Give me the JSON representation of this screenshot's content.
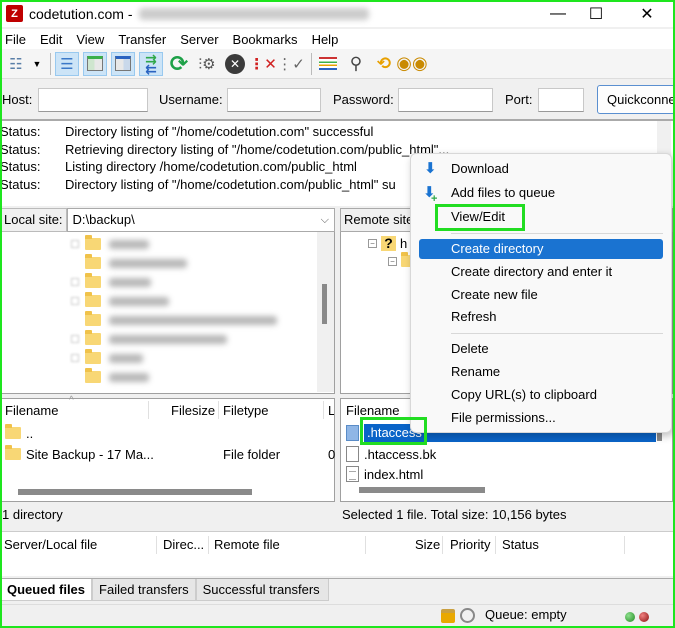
{
  "window": {
    "app_icon": "filezilla-icon",
    "title": "codetution.com -",
    "controls": {
      "minimize": "—",
      "maximize": "☐",
      "close": "✕"
    }
  },
  "menu": [
    "File",
    "Edit",
    "View",
    "Transfer",
    "Server",
    "Bookmarks",
    "Help"
  ],
  "toolbar": {
    "icons": [
      "site-manager-icon",
      "dropdown-arrow-icon",
      "toggle-message-log-icon",
      "toggle-local-tree-icon",
      "toggle-remote-tree-icon",
      "toggle-transfer-queue-icon",
      "refresh-icon",
      "process-queue-icon",
      "cancel-icon",
      "disconnect-icon",
      "reconnect-icon",
      "directory-comparison-icon",
      "filter-icon",
      "synchronized-browsing-icon",
      "search-icon"
    ]
  },
  "quickconnect": {
    "host_label": "Host:",
    "host_value": "",
    "username_label": "Username:",
    "username_value": "",
    "password_label": "Password:",
    "password_value": "",
    "port_label": "Port:",
    "port_value": "",
    "button": "Quickconnect"
  },
  "log": [
    {
      "key": "Status:",
      "msg": "Directory listing of \"/home/codetution.com\" successful"
    },
    {
      "key": "Status:",
      "msg": "Retrieving directory listing of \"/home/codetution.com/public_html\"..."
    },
    {
      "key": "Status:",
      "msg": "Listing directory /home/codetution.com/public_html"
    },
    {
      "key": "Status:",
      "msg": "Directory listing of \"/home/codetution.com/public_html\" su"
    }
  ],
  "local": {
    "label": "Local site:",
    "path": "D:\\backup\\",
    "columns": [
      "Filename",
      "Filesize",
      "Filetype",
      "L"
    ],
    "files": [
      {
        "name": "..",
        "size": "",
        "type": "",
        "last": ""
      },
      {
        "name": "Site Backup - 17 Ma...",
        "size": "",
        "type": "File folder",
        "last": "0"
      }
    ],
    "status": "1 directory"
  },
  "remote": {
    "label": "Remote site",
    "tree_root": "h",
    "columns": [
      "Filename"
    ],
    "files": [
      {
        "name": ".htaccess",
        "selected": true
      },
      {
        "name": ".htaccess.bk",
        "selected": false
      },
      {
        "name": "index.html",
        "selected": false
      }
    ],
    "status": "Selected 1 file. Total size: 10,156 bytes"
  },
  "context_menu": {
    "items": [
      {
        "label": "Download",
        "icon": "download-arrow-icon"
      },
      {
        "label": "Add files to queue",
        "icon": "add-to-queue-icon"
      },
      {
        "label": "View/Edit"
      },
      {
        "label": "Create directory",
        "highlighted": true
      },
      {
        "label": "Create directory and enter it"
      },
      {
        "label": "Create new file"
      },
      {
        "label": "Refresh"
      },
      {
        "label": "Delete"
      },
      {
        "label": "Rename"
      },
      {
        "label": "Copy URL(s) to clipboard"
      },
      {
        "label": "File permissions..."
      }
    ]
  },
  "queue": {
    "columns": [
      "Server/Local file",
      "Direc...",
      "Remote file",
      "Size",
      "Priority",
      "Status"
    ]
  },
  "tabs": [
    "Queued files",
    "Failed transfers",
    "Successful transfers"
  ],
  "statusbar": {
    "queue": "Queue: empty"
  },
  "colors": {
    "highlight_box": "#22dd22",
    "menu_highlight": "#1a73d1",
    "selection": "#0a64c8"
  }
}
